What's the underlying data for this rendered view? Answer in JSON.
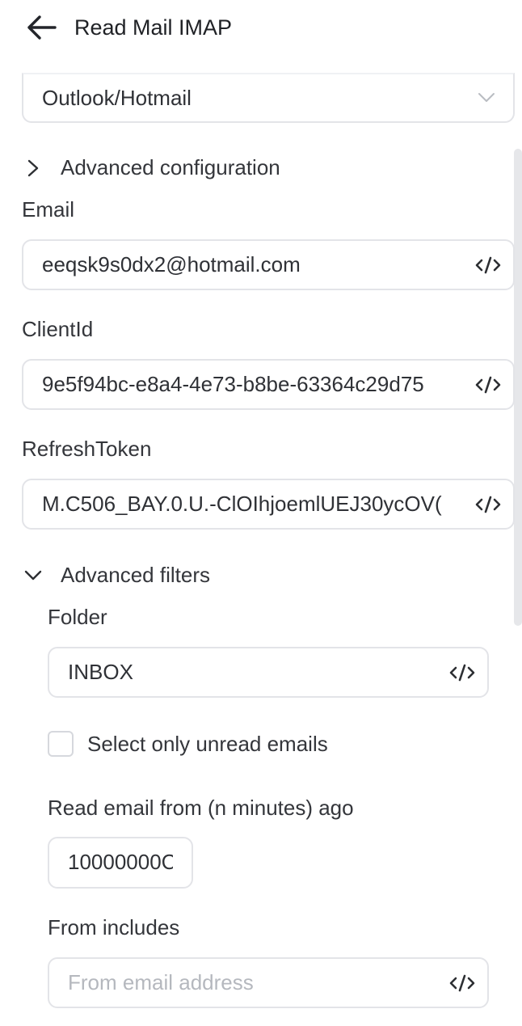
{
  "header": {
    "title": "Read Mail IMAP",
    "back_icon": "arrow-left-icon"
  },
  "provider_select": {
    "value": "Outlook/Hotmail",
    "icon": "chevron-down-icon"
  },
  "advanced_configuration": {
    "label": "Advanced configuration",
    "expanded": false,
    "icon": "chevron-right-icon"
  },
  "fields": {
    "email": {
      "label": "Email",
      "value": "eeqsk9s0dx2@hotmail.com"
    },
    "client_id": {
      "label": "ClientId",
      "value": "9e5f94bc-e8a4-4e73-b8be-63364c29d75"
    },
    "refresh_token": {
      "label": "RefreshToken",
      "value": "M.C506_BAY.0.U.-ClOIhjoemlUEJ30ycOV("
    }
  },
  "advanced_filters": {
    "label": "Advanced filters",
    "expanded": true,
    "icon": "chevron-down-icon",
    "folder": {
      "label": "Folder",
      "value": "INBOX"
    },
    "unread_only": {
      "label": "Select only unread emails",
      "checked": false
    },
    "read_from": {
      "label": "Read email from (n minutes) ago",
      "value": "10000000C"
    },
    "from_includes": {
      "label": "From includes",
      "placeholder": "From email address",
      "value": ""
    }
  },
  "code_icon": "code-icon",
  "colors": {
    "border": "#e3e4e8",
    "text": "#2f3136",
    "placeholder": "#b5b8be",
    "scrollbar": "#e6e7ea"
  }
}
